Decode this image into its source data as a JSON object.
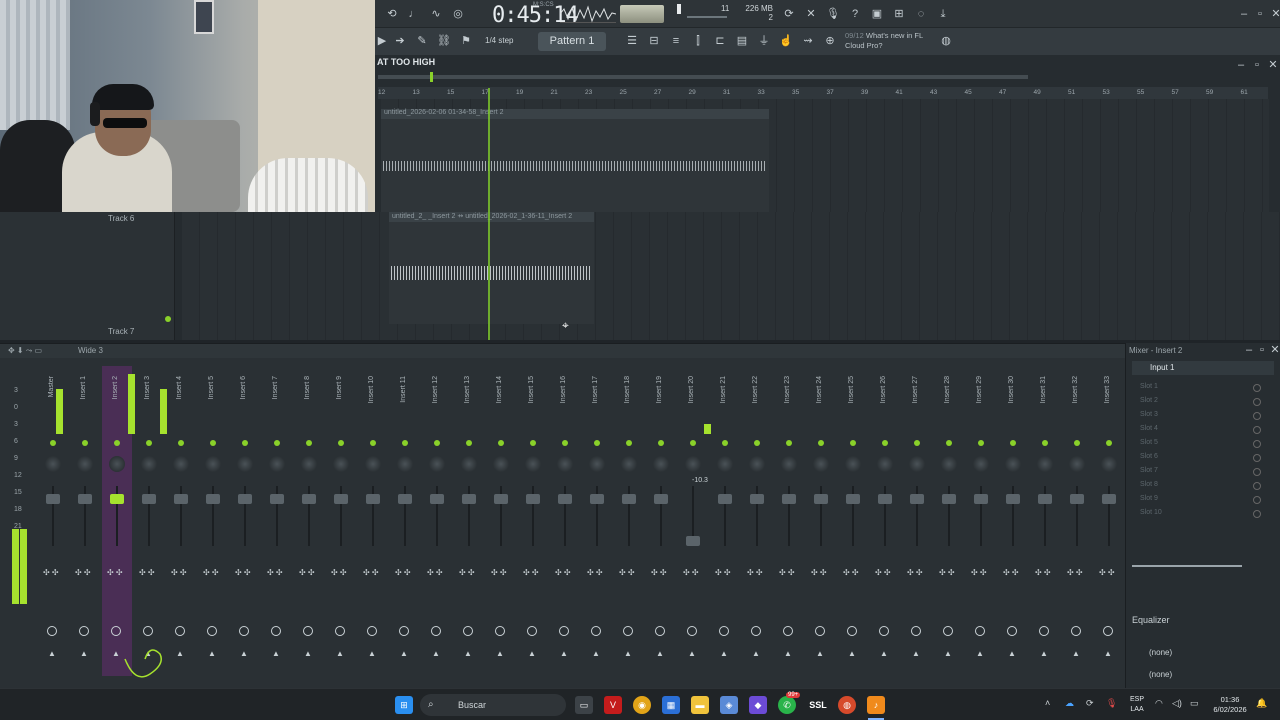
{
  "topbar": {
    "time": "0:45:14",
    "time_label": "M:S:CS",
    "cpu_value": "11",
    "mem_value": "226 MB",
    "mem_sub": "2"
  },
  "toolbar2": {
    "step": "1/4 step",
    "pattern": "Pattern 1",
    "news_date": "09/12",
    "news_text": "What's new in FL Cloud Pro?"
  },
  "playlist": {
    "title": "AT TOO HIGH",
    "ruler_ticks": [
      "12",
      "13",
      "15",
      "17",
      "19",
      "21",
      "23",
      "25",
      "27",
      "29",
      "31",
      "33",
      "35",
      "37",
      "39",
      "41",
      "43",
      "45",
      "47",
      "49",
      "51",
      "53",
      "55",
      "57",
      "59",
      "61"
    ],
    "ruler_labels": [
      "17",
      "29",
      "37",
      "41",
      "45",
      "49",
      "53",
      "57"
    ],
    "clip1_title": "untitled_2026-02-06 01-34-58_Insert 2",
    "clip2_title": "untitled_2_ _Insert 2 ⇸ untitled_2026-02_1-36-11_Insert 2"
  },
  "tracks": {
    "track6": "Track 6",
    "track7": "Track 7"
  },
  "mixer": {
    "header": "Wide 3",
    "strip_names": [
      "Master",
      "Insert 1",
      "Insert 2",
      "Insert 3",
      "Insert 4",
      "Insert 5",
      "Insert 6",
      "Insert 7",
      "Insert 8",
      "Insert 9",
      "Insert 10",
      "Insert 11",
      "Insert 12",
      "Insert 13",
      "Insert 14",
      "Insert 15",
      "Insert 16",
      "Insert 17",
      "Insert 18",
      "Insert 19",
      "Insert 20",
      "Insert 21",
      "Insert 22",
      "Insert 23",
      "Insert 24",
      "Insert 25",
      "Insert 26",
      "Insert 27",
      "Insert 28",
      "Insert 29",
      "Insert 30",
      "Insert 31",
      "Insert 32",
      "Insert 33"
    ],
    "scale": [
      "3",
      "0",
      "3",
      "6",
      "9",
      "12",
      "15",
      "18",
      "21"
    ],
    "fader_readout": "-10.3"
  },
  "insert_panel": {
    "title": "Mixer - Insert 2",
    "input": "Input 1",
    "slots": [
      "Slot 1",
      "Slot 2",
      "Slot 3",
      "Slot 4",
      "Slot 5",
      "Slot 6",
      "Slot 7",
      "Slot 8",
      "Slot 9",
      "Slot 10"
    ],
    "eq_label": "Equalizer",
    "none1": "(none)",
    "none2": "(none)"
  },
  "taskbar": {
    "search": "Buscar",
    "lang1": "ESP",
    "lang2": "LAA",
    "time": "01:36",
    "date": "6/02/2026",
    "badge": "99+",
    "ssl": "SSL"
  }
}
